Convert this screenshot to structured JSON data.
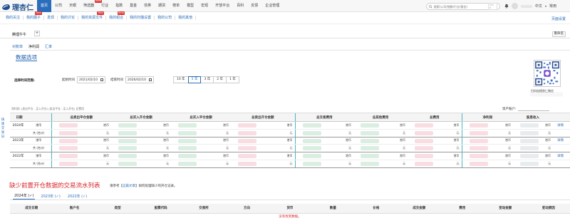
{
  "brand": {
    "name": "理杏仁"
  },
  "topnav": [
    {
      "label": "首页",
      "active": true,
      "hot": ""
    },
    {
      "label": "公司",
      "active": false,
      "hot": ""
    },
    {
      "label": "天眼",
      "active": false,
      "hot": ""
    },
    {
      "label": "筛选器",
      "active": false,
      "hot": "Beta"
    },
    {
      "label": "行业",
      "active": false,
      "hot": ""
    },
    {
      "label": "指数",
      "active": false,
      "hot": ""
    },
    {
      "label": "基金",
      "active": false,
      "hot": ""
    },
    {
      "label": "债券",
      "active": false,
      "hot": ""
    },
    {
      "label": "期货",
      "active": false,
      "hot": ""
    },
    {
      "label": "榜单",
      "active": false,
      "hot": ""
    },
    {
      "label": "模型",
      "active": false,
      "hot": ""
    },
    {
      "label": "宏观",
      "active": false,
      "hot": ""
    },
    {
      "label": "开放平台",
      "active": false,
      "hot": ""
    },
    {
      "label": "百科",
      "active": false,
      "hot": ""
    },
    {
      "label": "反馈",
      "active": false,
      "hot": ""
    },
    {
      "label": "企业管理",
      "active": false,
      "hot": ""
    }
  ],
  "search": {
    "placeholder": "搜索(公司/指数/行业/基金)",
    "shortcut": "Ctrl K"
  },
  "topright": {
    "lang": "中文",
    "quick": "常用"
  },
  "subnav": [
    {
      "label": "我的关注",
      "hot": ""
    },
    {
      "label": "我的圈子",
      "hot": "New"
    },
    {
      "label": "发现",
      "hot": ""
    },
    {
      "label": "我的讨论",
      "hot": ""
    },
    {
      "label": "我的资源文件",
      "hot": "New"
    },
    {
      "label": "我的组合",
      "hot": "Beta"
    },
    {
      "label": "我的扫描设置",
      "hot": ""
    },
    {
      "label": "我的公司",
      "hot": ""
    },
    {
      "label": "我的其他",
      "hot": ""
    }
  ],
  "layout_link": "页面设置",
  "portfolio": {
    "tab": "腾理牛牛",
    "add": "+",
    "rename": "重命名"
  },
  "view_tabs": [
    {
      "label": "对账单",
      "active": false
    },
    {
      "label": "净利润",
      "active": true
    },
    {
      "label": "汇率",
      "active": false
    }
  ],
  "section_title": "数据选项",
  "range": {
    "label": "选择时间范围:",
    "start_label": "起始时间",
    "start": "2021/02/10",
    "end_label": "结束时间",
    "end": "2026/02/10",
    "years": [
      {
        "label": "10 年",
        "active": false
      },
      {
        "label": "5 年",
        "active": true
      },
      {
        "label": "3 年",
        "active": false
      },
      {
        "label": "2 年",
        "active": false
      },
      {
        "label": "1 年",
        "active": false
      }
    ]
  },
  "qr_caption": "扫码加理杏仁微信",
  "filter_note": "净利润: (卖出平仓 - 买入开仓)  (卖出平仓 - 买入开仓) 总费用",
  "asset_account": {
    "label": "资产账户:"
  },
  "side_tab": [
    "快",
    "速",
    "交",
    "易",
    "日"
  ],
  "table": {
    "headers": [
      "日期",
      "",
      "总卖出平仓金额",
      "总买入开仓金额",
      "总买入平仓金额",
      "总卖出开仓金额",
      "总交易费用",
      "总其他费用",
      "总费用",
      "净利润",
      "股息收入",
      ""
    ],
    "rows": [
      {
        "year": "2024年",
        "type": "港币",
        "c": [
          "港币",
          "港币",
          "港币",
          "港币",
          "港币",
          "港币",
          "港币",
          "港币",
          "港币"
        ],
        "detail": "详情"
      },
      {
        "year": "",
        "type": "共 (合计)",
        "c": [
          "元",
          "元",
          "元",
          "元",
          "元",
          "元",
          "元",
          "元",
          "元"
        ],
        "detail": ""
      },
      {
        "year": "2023年",
        "type": "港币",
        "c": [
          "港币",
          "港币",
          "港币",
          "港币",
          "港币",
          "港币",
          "港币",
          "港币",
          "港币"
        ],
        "detail": "详情"
      },
      {
        "year": "",
        "type": "共 (合计)",
        "c": [
          "元",
          "元",
          "元",
          "元",
          "元",
          "元",
          "元",
          "元",
          "元"
        ],
        "detail": ""
      },
      {
        "year": "2022年",
        "type": "港币",
        "c": [
          "港币",
          "港币",
          "港币",
          "港币",
          "港币",
          "港币",
          "港币",
          "港币",
          "港币"
        ],
        "detail": "详情"
      },
      {
        "year": "",
        "type": "共 (合计)",
        "c": [
          "元",
          "元",
          "元",
          "元",
          "元",
          "元",
          "元",
          "元",
          "元"
        ],
        "detail": ""
      }
    ]
  },
  "missing": {
    "title": "缺少前置开仓数据的交易流水列表",
    "note_pre": "请参考【",
    "note_link": "这篇文章",
    "note_post": "】如何处理缺少的开仓记录。",
    "year_tabs": [
      {
        "label": "2024年 (✓)",
        "active": true
      },
      {
        "label": "2023年 (✓)",
        "active": false
      },
      {
        "label": "2022年 (✓)",
        "active": false
      }
    ],
    "headers": [
      "成交日期",
      "账户名",
      "类型",
      "股票代码",
      "交易所",
      "方向",
      "货币",
      "数量",
      "价格",
      "成交金额",
      "费用",
      "变动金额",
      "变动原因"
    ],
    "empty": "没有找到数据。"
  }
}
